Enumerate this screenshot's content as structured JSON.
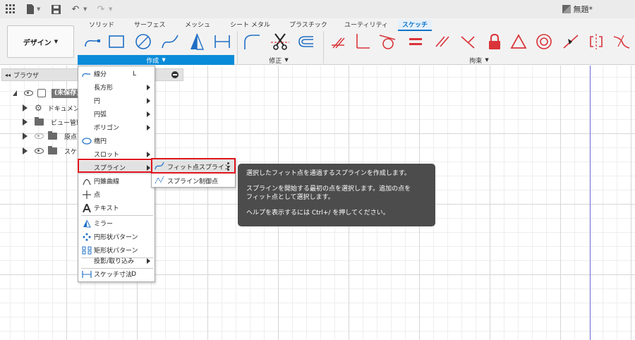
{
  "app": {
    "document_title": "無題*"
  },
  "ribbon": {
    "workspace_label": "デザイン",
    "tabs": [
      {
        "label": "ソリッド",
        "active": false
      },
      {
        "label": "サーフェス",
        "active": false
      },
      {
        "label": "メッシュ",
        "active": false
      },
      {
        "label": "シート メタル",
        "active": false
      },
      {
        "label": "プラスチック",
        "active": false
      },
      {
        "label": "ユーティリティ",
        "active": false
      },
      {
        "label": "スケッチ",
        "active": true
      }
    ],
    "groups": {
      "create": "作成",
      "modify": "修正",
      "constraints": "拘束"
    }
  },
  "browser": {
    "title": "ブラウザ",
    "items": [
      {
        "label": "(未保存)"
      },
      {
        "label": "ドキュメント"
      },
      {
        "label": "ビュー管理"
      },
      {
        "label": "原点"
      },
      {
        "label": "スケッチ"
      }
    ]
  },
  "create_menu": {
    "items": [
      {
        "label": "線分",
        "shortcut": "L"
      },
      {
        "label": "長方形"
      },
      {
        "label": "円"
      },
      {
        "label": "円弧"
      },
      {
        "label": "ポリゴン"
      },
      {
        "label": "楕円"
      },
      {
        "label": "スロット"
      },
      {
        "label": "スプライン"
      },
      {
        "label": "円錐曲線"
      },
      {
        "label": "点"
      },
      {
        "label": "テキスト"
      },
      {
        "label": "ミラー"
      },
      {
        "label": "円形状パターン"
      },
      {
        "label": "矩形状パターン"
      },
      {
        "label": "投影/取り込み"
      },
      {
        "label": "スケッチ寸法",
        "shortcut": "D"
      }
    ]
  },
  "spline_submenu": {
    "items": [
      {
        "label": "フィット点スプライン"
      },
      {
        "label": "スプライン制御点"
      }
    ]
  },
  "tooltip": {
    "line1": "選択したフィット点を通過するスプラインを作成します。",
    "line2a": "スプラインを開始する最初の点を選択します。追加の点を",
    "line2b": "フィット点として選択します。",
    "line3": "ヘルプを表示するには Ctrl+/ を押してください。"
  },
  "colors": {
    "accent": "#0a8bd8",
    "highlight_box": "#e0141d",
    "tooltip_bg": "#4c4c4c",
    "constraint_red": "#d9343a"
  }
}
